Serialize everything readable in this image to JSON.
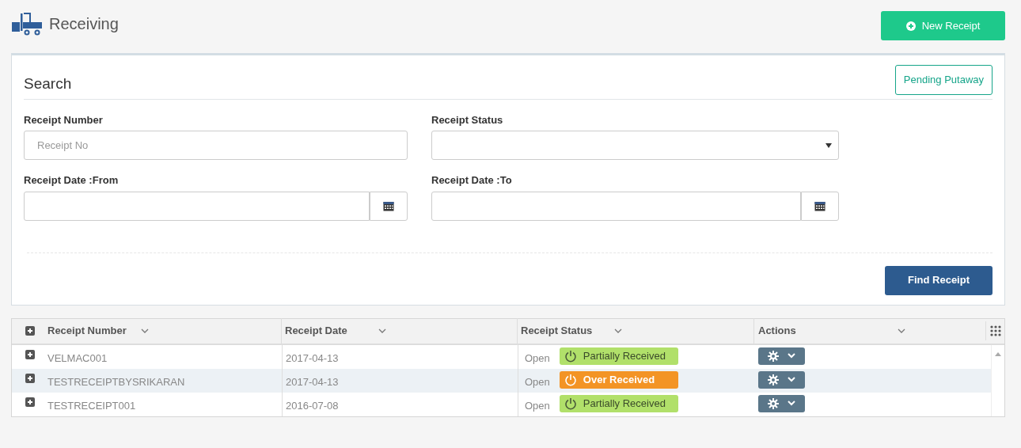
{
  "page": {
    "title": "Receiving",
    "new_button": "New Receipt"
  },
  "search": {
    "title": "Search",
    "pending_button": "Pending Putaway",
    "find_button": "Find Receipt",
    "fields": [
      {
        "label": "Receipt Number",
        "kind": "text",
        "placeholder": "Receipt No"
      },
      {
        "label": "Receipt Status",
        "kind": "select"
      },
      {
        "label": "Receipt Date :From",
        "kind": "date"
      },
      {
        "label": "Receipt Date :To",
        "kind": "date"
      }
    ]
  },
  "table": {
    "columns": [
      "Receipt Number",
      "Receipt Date",
      "Receipt Status",
      "Actions"
    ],
    "rows": [
      {
        "number": "VELMAC001",
        "date": "2017-04-13",
        "state": "Open",
        "status": "Partially Received",
        "color": "#b1e06a",
        "selected": false
      },
      {
        "number": "TESTRECEIPTBYSRIKARAN",
        "date": "2017-04-13",
        "state": "Open",
        "status": "Over Received",
        "color": "#f39425",
        "selected": true
      },
      {
        "number": "TESTRECEIPT001",
        "date": "2016-07-08",
        "state": "Open",
        "status": "Partially Received",
        "color": "#b1e06a",
        "selected": false
      }
    ]
  }
}
